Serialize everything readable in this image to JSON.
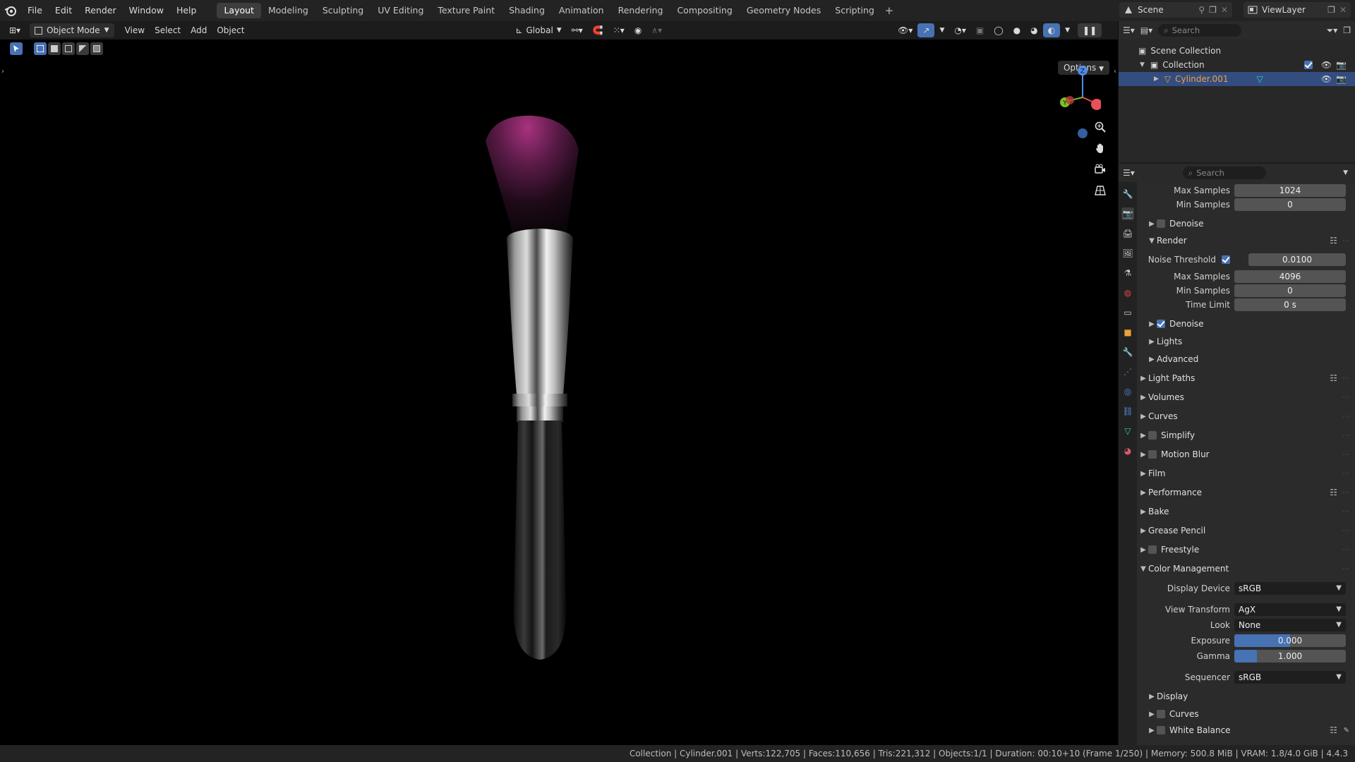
{
  "topbar": {
    "menus": [
      "File",
      "Edit",
      "Render",
      "Window",
      "Help"
    ],
    "workspaces": [
      "Layout",
      "Modeling",
      "Sculpting",
      "UV Editing",
      "Texture Paint",
      "Shading",
      "Animation",
      "Rendering",
      "Compositing",
      "Geometry Nodes",
      "Scripting"
    ],
    "active_workspace": "Layout",
    "scene": "Scene",
    "view_layer": "ViewLayer"
  },
  "viewport": {
    "mode": "Object Mode",
    "menus": [
      "View",
      "Select",
      "Add",
      "Object"
    ],
    "orientation": "Global",
    "options_label": "Options",
    "gizmo_axes": [
      "Z",
      "Y",
      "X"
    ]
  },
  "outliner": {
    "search_placeholder": "Search",
    "scene_collection": "Scene Collection",
    "collection": "Collection",
    "object": "Cylinder.001"
  },
  "properties": {
    "search_placeholder": "Search",
    "viewport_max_samples_label": "Max Samples",
    "viewport_max_samples": "1024",
    "viewport_min_samples_label": "Min Samples",
    "viewport_min_samples": "0",
    "denoise_label": "Denoise",
    "render_label": "Render",
    "noise_threshold_label": "Noise Threshold",
    "noise_threshold": "0.0100",
    "render_max_samples_label": "Max Samples",
    "render_max_samples": "4096",
    "render_min_samples_label": "Min Samples",
    "render_min_samples": "0",
    "time_limit_label": "Time Limit",
    "time_limit": "0 s",
    "render_denoise_label": "Denoise",
    "lights_label": "Lights",
    "advanced_label": "Advanced",
    "panels": [
      "Light Paths",
      "Volumes",
      "Curves",
      "Simplify",
      "Motion Blur",
      "Film",
      "Performance",
      "Bake",
      "Grease Pencil",
      "Freestyle"
    ],
    "color_management_label": "Color Management",
    "display_device_label": "Display Device",
    "display_device": "sRGB",
    "view_transform_label": "View Transform",
    "view_transform": "AgX",
    "look_label": "Look",
    "look": "None",
    "exposure_label": "Exposure",
    "exposure": "0.000",
    "exposure_fill": 0.5,
    "gamma_label": "Gamma",
    "gamma": "1.000",
    "gamma_fill": 0.2,
    "sequencer_label": "Sequencer",
    "sequencer": "sRGB",
    "sub_display_label": "Display",
    "sub_curves_label": "Curves",
    "sub_white_balance_label": "White Balance"
  },
  "statusbar": {
    "text": "Collection | Cylinder.001 | Verts:122,705 | Faces:110,656 | Tris:221,312 | Objects:1/1 | Duration: 00:10+10 (Frame 1/250) | Memory: 500.8 MiB | VRAM: 1.8/4.0 GiB | 4.4.3"
  },
  "colors": {
    "accent": "#4772b3",
    "selected_row": "#334d80",
    "object_orange": "#e8a23c",
    "bristle_pink": "#8a2a6a"
  }
}
